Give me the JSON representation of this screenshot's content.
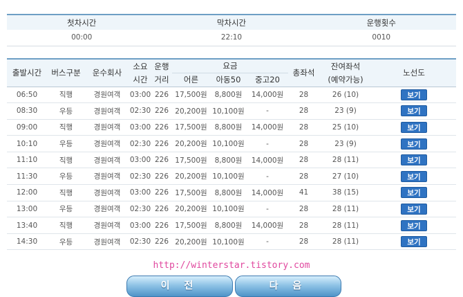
{
  "summary": {
    "headers": [
      "첫차시간",
      "막차시간",
      "운행횟수"
    ],
    "values": [
      "00:00",
      "22:10",
      "0010"
    ]
  },
  "table": {
    "headers": {
      "departure": "출발시간",
      "bus_type": "버스구분",
      "company": "운수회사",
      "duration_top": "소요",
      "duration_bottom": "시간",
      "distance_top": "운행",
      "distance_bottom": "거리",
      "fare": "요금",
      "fare_adult": "어른",
      "fare_child": "아동50",
      "fare_student": "중고20",
      "total_seats": "총좌석",
      "remaining_top": "잔여좌석",
      "remaining_bottom": "(예약가능)",
      "route_map": "노선도"
    },
    "rows": [
      {
        "time": "06:50",
        "type": "직행",
        "company": "경원여객",
        "duration": "03:00",
        "distance": "226",
        "adult": "17,500원",
        "child": "8,800원",
        "student": "14,000원",
        "seats": "28",
        "remaining": "26 (10)",
        "action": "보기"
      },
      {
        "time": "08:30",
        "type": "우등",
        "company": "경원여객",
        "duration": "02:30",
        "distance": "226",
        "adult": "20,200원",
        "child": "10,100원",
        "student": "-",
        "seats": "28",
        "remaining": "23 (9)",
        "action": "보기"
      },
      {
        "time": "09:00",
        "type": "직행",
        "company": "경원여객",
        "duration": "03:00",
        "distance": "226",
        "adult": "17,500원",
        "child": "8,800원",
        "student": "14,000원",
        "seats": "28",
        "remaining": "25 (10)",
        "action": "보기"
      },
      {
        "time": "10:10",
        "type": "우등",
        "company": "경원여객",
        "duration": "02:30",
        "distance": "226",
        "adult": "20,200원",
        "child": "10,100원",
        "student": "-",
        "seats": "28",
        "remaining": "23 (9)",
        "action": "보기"
      },
      {
        "time": "11:10",
        "type": "직행",
        "company": "경원여객",
        "duration": "03:00",
        "distance": "226",
        "adult": "17,500원",
        "child": "8,800원",
        "student": "14,000원",
        "seats": "28",
        "remaining": "28 (11)",
        "action": "보기"
      },
      {
        "time": "11:30",
        "type": "우등",
        "company": "경원여객",
        "duration": "02:30",
        "distance": "226",
        "adult": "20,200원",
        "child": "10,100원",
        "student": "-",
        "seats": "28",
        "remaining": "27 (10)",
        "action": "보기"
      },
      {
        "time": "12:00",
        "type": "직행",
        "company": "경원여객",
        "duration": "03:00",
        "distance": "226",
        "adult": "17,500원",
        "child": "8,800원",
        "student": "14,000원",
        "seats": "41",
        "remaining": "38 (15)",
        "action": "보기"
      },
      {
        "time": "13:00",
        "type": "우등",
        "company": "경원여객",
        "duration": "02:30",
        "distance": "226",
        "adult": "20,200원",
        "child": "10,100원",
        "student": "-",
        "seats": "28",
        "remaining": "28 (11)",
        "action": "보기"
      },
      {
        "time": "13:40",
        "type": "직행",
        "company": "경원여객",
        "duration": "03:00",
        "distance": "226",
        "adult": "17,500원",
        "child": "8,800원",
        "student": "14,000원",
        "seats": "28",
        "remaining": "28 (11)",
        "action": "보기"
      },
      {
        "time": "14:30",
        "type": "우등",
        "company": "경원여객",
        "duration": "02:30",
        "distance": "226",
        "adult": "20,200원",
        "child": "10,100원",
        "student": "-",
        "seats": "28",
        "remaining": "28 (11)",
        "action": "보기"
      }
    ]
  },
  "watermark": "http://winterstar.tistory.com",
  "nav": {
    "prev": "이 전",
    "next": "다 음"
  }
}
